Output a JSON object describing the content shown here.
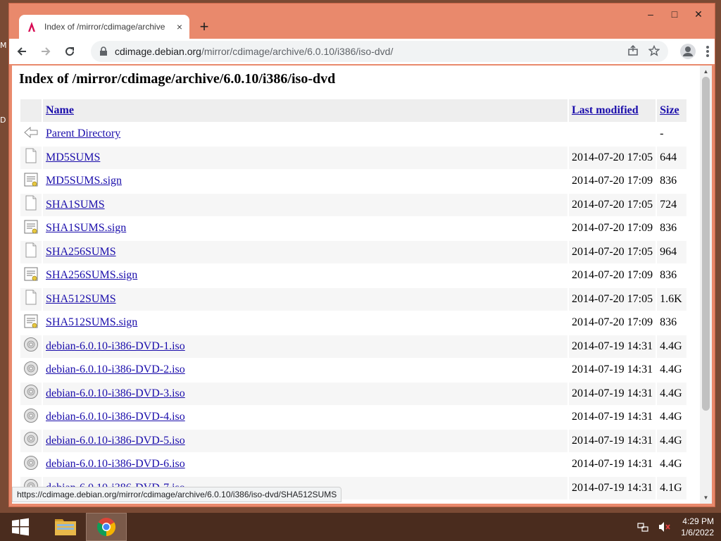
{
  "desktop": {
    "glyphs": [
      "M",
      "D"
    ]
  },
  "tab": {
    "title": "Index of /mirror/cdimage/archive",
    "close": "×",
    "new_tab": "+"
  },
  "window": {
    "minimize": "–",
    "maximize": "□",
    "close": "✕"
  },
  "address": {
    "host": "cdimage.debian.org",
    "path": "/mirror/cdimage/archive/6.0.10/i386/iso-dvd/"
  },
  "page": {
    "title": "Index of /mirror/cdimage/archive/6.0.10/i386/iso-dvd",
    "headers": {
      "name": "Name",
      "modified": "Last modified",
      "size": "Size"
    },
    "parent": {
      "name": "Parent Directory",
      "size": "-"
    },
    "rows": [
      {
        "icon": "text",
        "name": "MD5SUMS",
        "modified": "2014-07-20 17:05",
        "size": "644"
      },
      {
        "icon": "sign",
        "name": "MD5SUMS.sign",
        "modified": "2014-07-20 17:09",
        "size": "836"
      },
      {
        "icon": "text",
        "name": "SHA1SUMS",
        "modified": "2014-07-20 17:05",
        "size": "724"
      },
      {
        "icon": "sign",
        "name": "SHA1SUMS.sign",
        "modified": "2014-07-20 17:09",
        "size": "836"
      },
      {
        "icon": "text",
        "name": "SHA256SUMS",
        "modified": "2014-07-20 17:05",
        "size": "964"
      },
      {
        "icon": "sign",
        "name": "SHA256SUMS.sign",
        "modified": "2014-07-20 17:09",
        "size": "836"
      },
      {
        "icon": "text",
        "name": "SHA512SUMS",
        "modified": "2014-07-20 17:05",
        "size": "1.6K"
      },
      {
        "icon": "sign",
        "name": "SHA512SUMS.sign",
        "modified": "2014-07-20 17:09",
        "size": "836"
      },
      {
        "icon": "disc",
        "name": "debian-6.0.10-i386-DVD-1.iso",
        "modified": "2014-07-19 14:31",
        "size": "4.4G"
      },
      {
        "icon": "disc",
        "name": "debian-6.0.10-i386-DVD-2.iso",
        "modified": "2014-07-19 14:31",
        "size": "4.4G"
      },
      {
        "icon": "disc",
        "name": "debian-6.0.10-i386-DVD-3.iso",
        "modified": "2014-07-19 14:31",
        "size": "4.4G"
      },
      {
        "icon": "disc",
        "name": "debian-6.0.10-i386-DVD-4.iso",
        "modified": "2014-07-19 14:31",
        "size": "4.4G"
      },
      {
        "icon": "disc",
        "name": "debian-6.0.10-i386-DVD-5.iso",
        "modified": "2014-07-19 14:31",
        "size": "4.4G"
      },
      {
        "icon": "disc",
        "name": "debian-6.0.10-i386-DVD-6.iso",
        "modified": "2014-07-19 14:31",
        "size": "4.4G"
      },
      {
        "icon": "disc",
        "name": "debian-6.0.10-i386-DVD-7.iso",
        "modified": "2014-07-19 14:31",
        "size": "4.1G"
      }
    ]
  },
  "status_url": "https://cdimage.debian.org/mirror/cdimage/archive/6.0.10/i386/iso-dvd/SHA512SUMS",
  "taskbar": {
    "time": "4:29 PM",
    "date": "1/6/2022"
  },
  "colors": {
    "link": "#1a0dab",
    "accent": "#e9896c"
  }
}
